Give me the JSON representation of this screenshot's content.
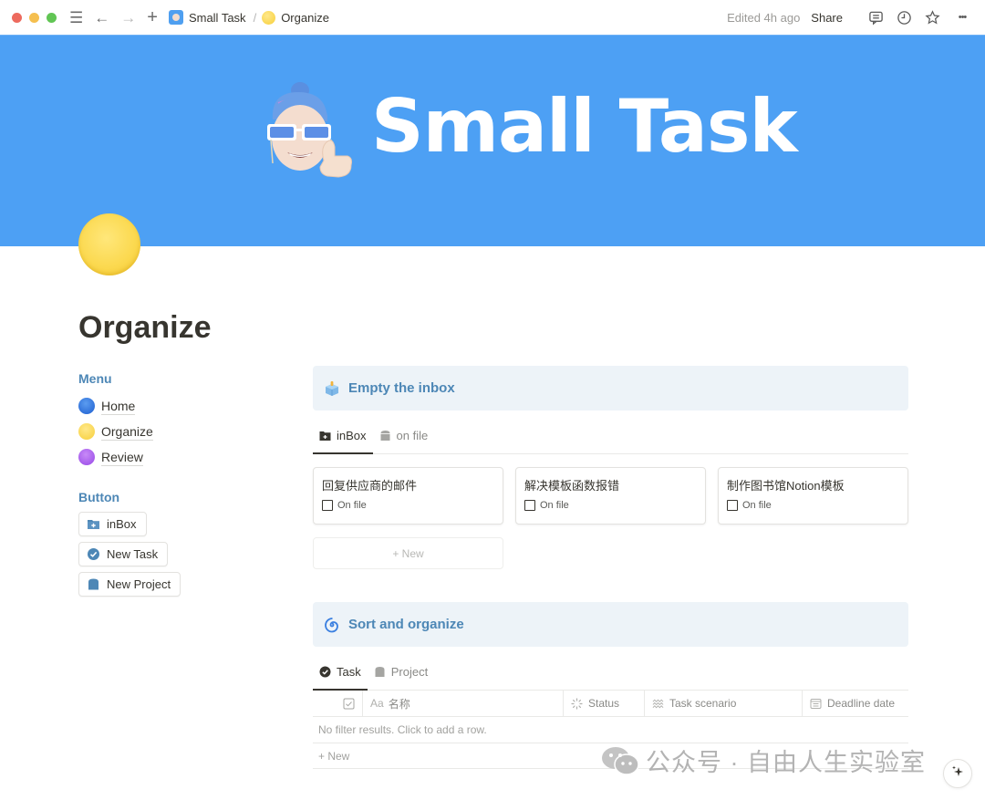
{
  "window": {
    "breadcrumb": [
      {
        "label": "Small Task",
        "icon": "memoji-avatar-icon"
      },
      {
        "label": "Organize",
        "icon": "yellow-circle-icon"
      }
    ],
    "breadcrumb_separator": "/",
    "edited": "Edited 4h ago",
    "share_label": "Share",
    "icons": [
      "sidebar-menu-icon",
      "back-arrow-icon",
      "forward-arrow-icon",
      "plus-icon",
      "comment-icon",
      "history-clock-icon",
      "star-icon",
      "more-icon"
    ],
    "nav_glyphs": {
      "menu": "☰",
      "back": "←",
      "forward": "→",
      "plus": "+"
    },
    "more_glyph": "•••"
  },
  "cover": {
    "title": "Small Task",
    "background": "#4da0f4"
  },
  "page": {
    "icon": "yellow-circle-icon",
    "title": "Organize"
  },
  "menu": {
    "label": "Menu",
    "items": [
      {
        "label": "Home",
        "icon": "blue-circle-icon"
      },
      {
        "label": "Organize",
        "icon": "yellow-circle-icon"
      },
      {
        "label": "Review",
        "icon": "purple-circle-icon"
      }
    ]
  },
  "buttons": {
    "label": "Button",
    "items": [
      {
        "label": "inBox",
        "icon": "folder-plus-icon"
      },
      {
        "label": "New Task",
        "icon": "check-circle-icon"
      },
      {
        "label": "New Project",
        "icon": "archive-icon"
      }
    ]
  },
  "inbox_section": {
    "callout": "Empty the inbox",
    "tabs": [
      {
        "label": "inBox",
        "active": true
      },
      {
        "label": "on file",
        "active": false
      }
    ],
    "cards": [
      {
        "title": "回复供应商的邮件",
        "prop_label": "On file",
        "checked": false
      },
      {
        "title": "解决模板函数报错",
        "prop_label": "On file",
        "checked": false
      },
      {
        "title": "制作图书馆Notion模板",
        "prop_label": "On file",
        "checked": false
      }
    ],
    "new_label": "+ New"
  },
  "sort_section": {
    "callout": "Sort and organize",
    "tabs": [
      {
        "label": "Task",
        "active": true
      },
      {
        "label": "Project",
        "active": false
      }
    ],
    "columns": [
      {
        "label": "",
        "icon": "checkbox-icon"
      },
      {
        "label": "名称",
        "prefix": "Aa",
        "icon": "title-icon"
      },
      {
        "label": "Status",
        "icon": "status-icon"
      },
      {
        "label": "Task scenario",
        "icon": "multi-select-icon"
      },
      {
        "label": "Deadline date",
        "icon": "calendar-icon"
      }
    ],
    "empty_text": "No filter results. Click to add a row.",
    "new_row_label": "+ New"
  },
  "watermark": {
    "text": "公众号 · 自由人生实验室"
  },
  "colors": {
    "accent_blue_text": "#4d87b6",
    "callout_bg": "#edf3f8",
    "text": "#37352f"
  }
}
